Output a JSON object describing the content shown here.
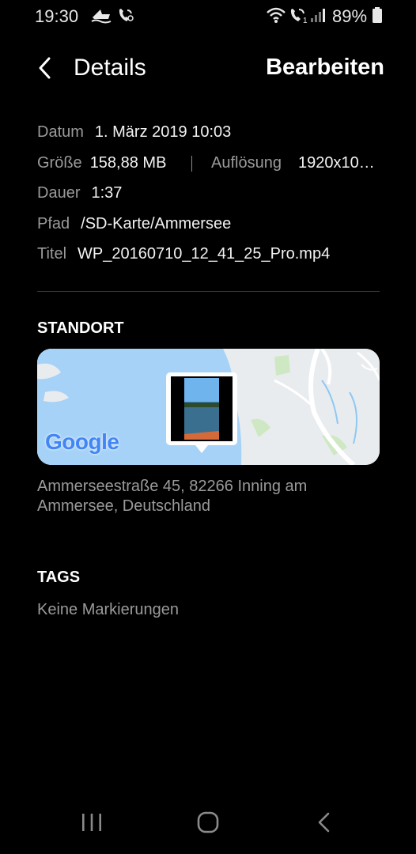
{
  "status_bar": {
    "time": "19:30",
    "battery": "89%",
    "icons": [
      "boat-icon",
      "wifi-calling-icon",
      "wifi-icon",
      "volte-call-icon",
      "signal-icon",
      "battery-icon"
    ]
  },
  "header": {
    "title": "Details",
    "edit_label": "Bearbeiten"
  },
  "details": {
    "date_label": "Datum",
    "date_value": "1. März 2019 10:03",
    "size_label": "Größe",
    "size_value": "158,88 MB",
    "resolution_label": "Auflösung",
    "resolution_value": "1920x10…",
    "duration_label": "Dauer",
    "duration_value": "1:37",
    "path_label": "Pfad",
    "path_value": "/SD-Karte/Ammersee",
    "title_label": "Titel",
    "title_value": "WP_20160710_12_41_25_Pro.mp4"
  },
  "location": {
    "section_title": "STANDORT",
    "map_logo": "Google",
    "address": "Ammerseestraße 45, 82266 Inning am Ammersee, Deutschland"
  },
  "tags": {
    "section_title": "TAGS",
    "empty_text": "Keine Markierungen"
  },
  "colors": {
    "background": "#000000",
    "label": "#9a9a9a",
    "value": "#f2f2f2",
    "water": "#a7d2f7",
    "land": "#e9ecef"
  },
  "nav_bar": {
    "icons": [
      "recent-apps-icon",
      "home-icon",
      "back-icon"
    ]
  }
}
